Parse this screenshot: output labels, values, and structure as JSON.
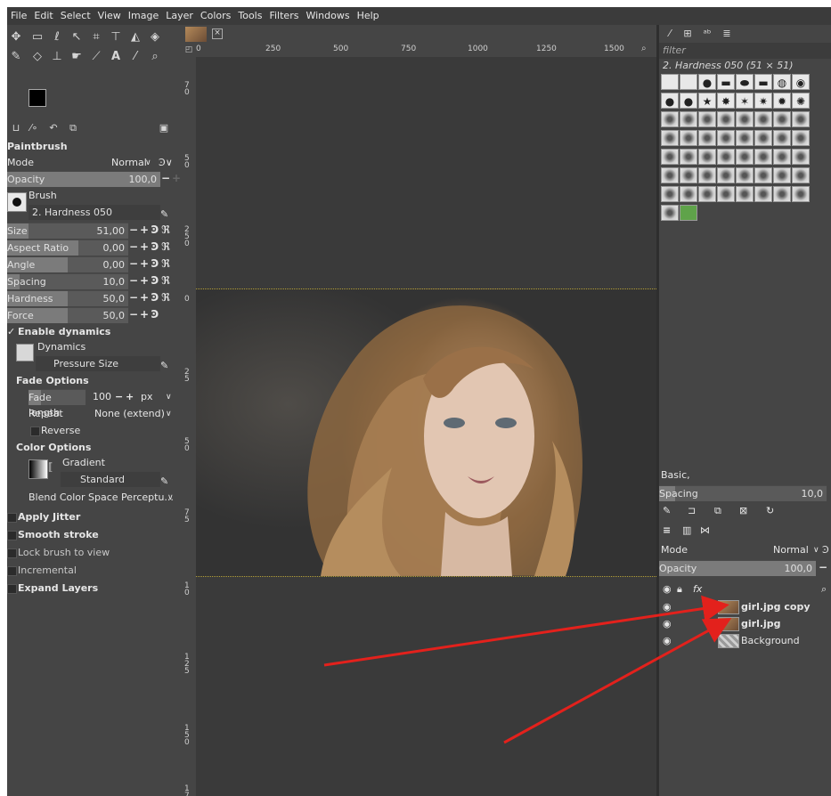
{
  "menubar": [
    "File",
    "Edit",
    "Select",
    "View",
    "Image",
    "Layer",
    "Colors",
    "Tools",
    "Filters",
    "Windows",
    "Help"
  ],
  "tool_icons": [
    "move-icon",
    "rect-select-icon",
    "lasso-icon",
    "fuzzy-select-icon",
    "crop-icon",
    "unified-transform-icon",
    "warp-icon",
    "bucket-fill-icon",
    "paintbrush-icon",
    "eraser-icon",
    "clone-icon",
    "smudge-icon",
    "path-icon",
    "text-icon",
    "color-picker-icon",
    "zoom-icon"
  ],
  "tool_options": {
    "title": "Paintbrush",
    "mode_label": "Mode",
    "mode_value": "Normal",
    "opacity_label": "Opacity",
    "opacity_value": "100,0",
    "brush_label": "Brush",
    "brush_value": "2. Hardness 050",
    "size_label": "Size",
    "size_value": "51,00",
    "aspect_label": "Aspect Ratio",
    "aspect_value": "0,00",
    "angle_label": "Angle",
    "angle_value": "0,00",
    "spacing_label": "Spacing",
    "spacing_value": "10,0",
    "hardness_label": "Hardness",
    "hardness_value": "50,0",
    "force_label": "Force",
    "force_value": "50,0",
    "enable_dynamics": "Enable dynamics",
    "dynamics_label": "Dynamics",
    "dynamics_value": "Pressure Size",
    "fade_options": "Fade Options",
    "fade_length_label": "Fade length",
    "fade_length_value": "100",
    "fade_unit": "px",
    "repeat_label": "Repeat",
    "repeat_value": "None (extend)",
    "reverse_label": "Reverse",
    "color_options": "Color Options",
    "gradient_label": "Gradient",
    "gradient_value": "Standard",
    "blend_space": "Blend Color Space Perceptu...",
    "apply_jitter": "Apply Jitter",
    "smooth_stroke": "Smooth stroke",
    "lock_brush": "Lock brush to view",
    "incremental": "Incremental",
    "expand_layers": "Expand Layers"
  },
  "ruler": {
    "h_ticks": [
      "0",
      "250",
      "500",
      "750",
      "1000",
      "1250",
      "1500"
    ],
    "v_ticks": [
      "7\n0",
      "5\n0",
      "2\n5\n0",
      "0",
      "2\n5",
      "5\n0",
      "7\n5",
      "1\n0",
      "1\n2\n5",
      "1\n5\n0",
      "1\n7"
    ]
  },
  "brushes": {
    "filter_placeholder": "filter",
    "selected_name": "2. Hardness 050 (51 × 51)",
    "set": "Basic,",
    "spacing_label": "Spacing",
    "spacing_value": "10,0"
  },
  "layers": {
    "mode_label": "Mode",
    "mode_value": "Normal",
    "opacity_label": "Opacity",
    "opacity_value": "100,0",
    "items": [
      {
        "name": "girl.jpg copy",
        "bold": true
      },
      {
        "name": "girl.jpg",
        "bold": true
      },
      {
        "name": "Background",
        "bold": false
      }
    ]
  },
  "colors": {
    "annotation_arrow": "#e3211c",
    "bg_panel": "#454545",
    "canvas_bg": "#3a3a3a"
  }
}
